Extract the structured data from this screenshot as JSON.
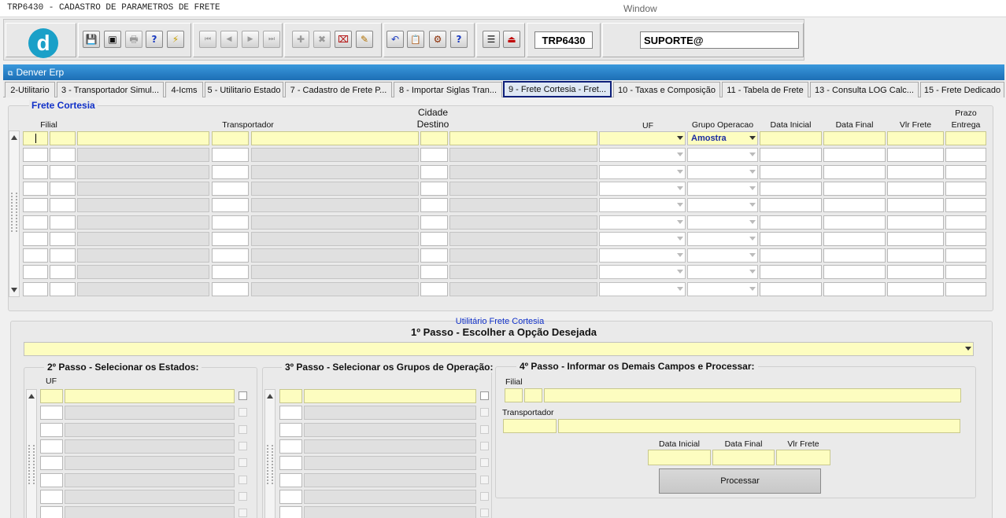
{
  "window": {
    "title": "TRP6430 - CADASTRO DE PARAMETROS DE FRETE",
    "menu_label": "Window"
  },
  "toolbar": {
    "logo_letter": "d",
    "form_code": "TRP6430",
    "user": "SUPORTE@",
    "buttons": [
      {
        "name": "save-icon",
        "glyph": "💾"
      },
      {
        "name": "print-preview-icon",
        "glyph": "▣"
      },
      {
        "name": "printer-icon",
        "glyph": "🖶"
      },
      {
        "name": "query-icon",
        "glyph": "?"
      },
      {
        "name": "execute-query-icon",
        "glyph": "⚡"
      },
      {
        "name": "first-record-icon",
        "glyph": "⏮"
      },
      {
        "name": "previous-record-icon",
        "glyph": "◀"
      },
      {
        "name": "next-record-icon",
        "glyph": "▶"
      },
      {
        "name": "last-record-icon",
        "glyph": "⏭"
      },
      {
        "name": "insert-record-icon",
        "glyph": "✚"
      },
      {
        "name": "delete-record-icon",
        "glyph": "✖"
      },
      {
        "name": "clear-record-icon",
        "glyph": "⌧"
      },
      {
        "name": "edit-icon",
        "glyph": "✎"
      },
      {
        "name": "undo-icon",
        "glyph": "↶"
      },
      {
        "name": "clipboard-icon",
        "glyph": "📋"
      },
      {
        "name": "tools-icon",
        "glyph": "⚙"
      },
      {
        "name": "help-icon",
        "glyph": "?"
      },
      {
        "name": "menu-icon",
        "glyph": "☰"
      },
      {
        "name": "exit-icon",
        "glyph": "⏏"
      }
    ]
  },
  "app": {
    "title": "Denver Erp"
  },
  "tabs": [
    {
      "label": "2-Utilitario"
    },
    {
      "label": "3 - Transportador Simul..."
    },
    {
      "label": "4-Icms"
    },
    {
      "label": "5 - Utilitario Estado"
    },
    {
      "label": "7 - Cadastro de Frete P..."
    },
    {
      "label": "8 - Importar Siglas Tran..."
    },
    {
      "label": "9 - Frete Cortesia - Fret...",
      "active": true
    },
    {
      "label": "10 - Taxas e Composição"
    },
    {
      "label": "11 - Tabela de Frete"
    },
    {
      "label": "13 - Consulta LOG Calc..."
    },
    {
      "label": "15 - Frete Dedicado"
    }
  ],
  "frete_cortesia": {
    "title": "Frete Cortesia",
    "columns": {
      "filial": "Filial",
      "transportador": "Transportador",
      "cidade_destino_1": "Cidade",
      "cidade_destino_2": "Destino",
      "uf": "UF",
      "grupo_operacao": "Grupo Operacao",
      "data_inicial": "Data Inicial",
      "data_final": "Data Final",
      "vlr_frete": "Vlr Frete",
      "prazo_entrega_1": "Prazo",
      "prazo_entrega_2": "Entrega"
    },
    "first_row_grupo_operacao": "Amostra"
  },
  "utilitario": {
    "title": "Utilitário Frete Cortesia",
    "passo1": "1º Passo - Escolher a Opção Desejada",
    "passo2": "2º Passo - Selecionar os Estados:",
    "passo2_uf": "UF",
    "passo3": "3º Passo - Selecionar os Grupos de Operação:",
    "passo4": "4º Passo - Informar os Demais Campos e Processar:",
    "filial": "Filial",
    "transportador": "Transportador",
    "data_inicial": "Data Inicial",
    "data_final": "Data Final",
    "vlr_frete": "Vlr Frete",
    "processar": "Processar"
  }
}
